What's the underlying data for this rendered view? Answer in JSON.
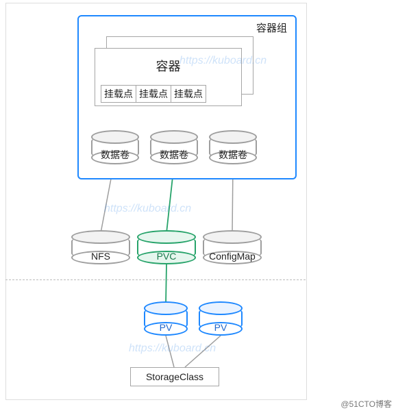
{
  "labels": {
    "pod_group": "容器组",
    "container": "容器",
    "mount": "挂载点",
    "volume": "数据卷",
    "nfs": "NFS",
    "pvc": "PVC",
    "configmap": "ConfigMap",
    "pv": "PV",
    "storage_class": "StorageClass"
  },
  "watermark": "https://kuboard.cn",
  "attribution": "@51CTO博客",
  "diagram": {
    "nodes": [
      {
        "id": "pod",
        "type": "group",
        "label_key": "pod_group"
      },
      {
        "id": "container",
        "type": "box",
        "label_key": "container",
        "mount_points": 3
      },
      {
        "id": "vol1",
        "type": "cylinder",
        "label_key": "volume",
        "color": "gray"
      },
      {
        "id": "vol2",
        "type": "cylinder",
        "label_key": "volume",
        "color": "gray"
      },
      {
        "id": "vol3",
        "type": "cylinder",
        "label_key": "volume",
        "color": "gray"
      },
      {
        "id": "nfs",
        "type": "cylinder",
        "label_key": "nfs",
        "color": "gray"
      },
      {
        "id": "pvc",
        "type": "cylinder",
        "label_key": "pvc",
        "color": "green"
      },
      {
        "id": "configmap",
        "type": "cylinder",
        "label_key": "configmap",
        "color": "gray"
      },
      {
        "id": "pv1",
        "type": "cylinder",
        "label_key": "pv",
        "color": "blue"
      },
      {
        "id": "pv2",
        "type": "cylinder",
        "label_key": "pv",
        "color": "blue"
      },
      {
        "id": "storageclass",
        "type": "box",
        "label_key": "storage_class"
      }
    ],
    "edges": [
      {
        "from": "container.mount1",
        "to": "vol1",
        "color": "gray"
      },
      {
        "from": "container.mount2",
        "to": "vol2",
        "color": "gray"
      },
      {
        "from": "container.mount2",
        "to": "vol1",
        "color": "gray"
      },
      {
        "from": "container.mount3",
        "to": "vol3",
        "color": "gray"
      },
      {
        "from": "vol1",
        "to": "nfs",
        "color": "gray"
      },
      {
        "from": "vol2",
        "to": "pvc",
        "color": "green"
      },
      {
        "from": "vol3",
        "to": "configmap",
        "color": "gray"
      },
      {
        "from": "pvc",
        "to": "pv1",
        "color": "green"
      },
      {
        "from": "pv1",
        "to": "storageclass",
        "color": "gray"
      },
      {
        "from": "pv2",
        "to": "storageclass",
        "color": "gray"
      }
    ],
    "separator": "namespaced / cluster boundary (dashed)"
  }
}
